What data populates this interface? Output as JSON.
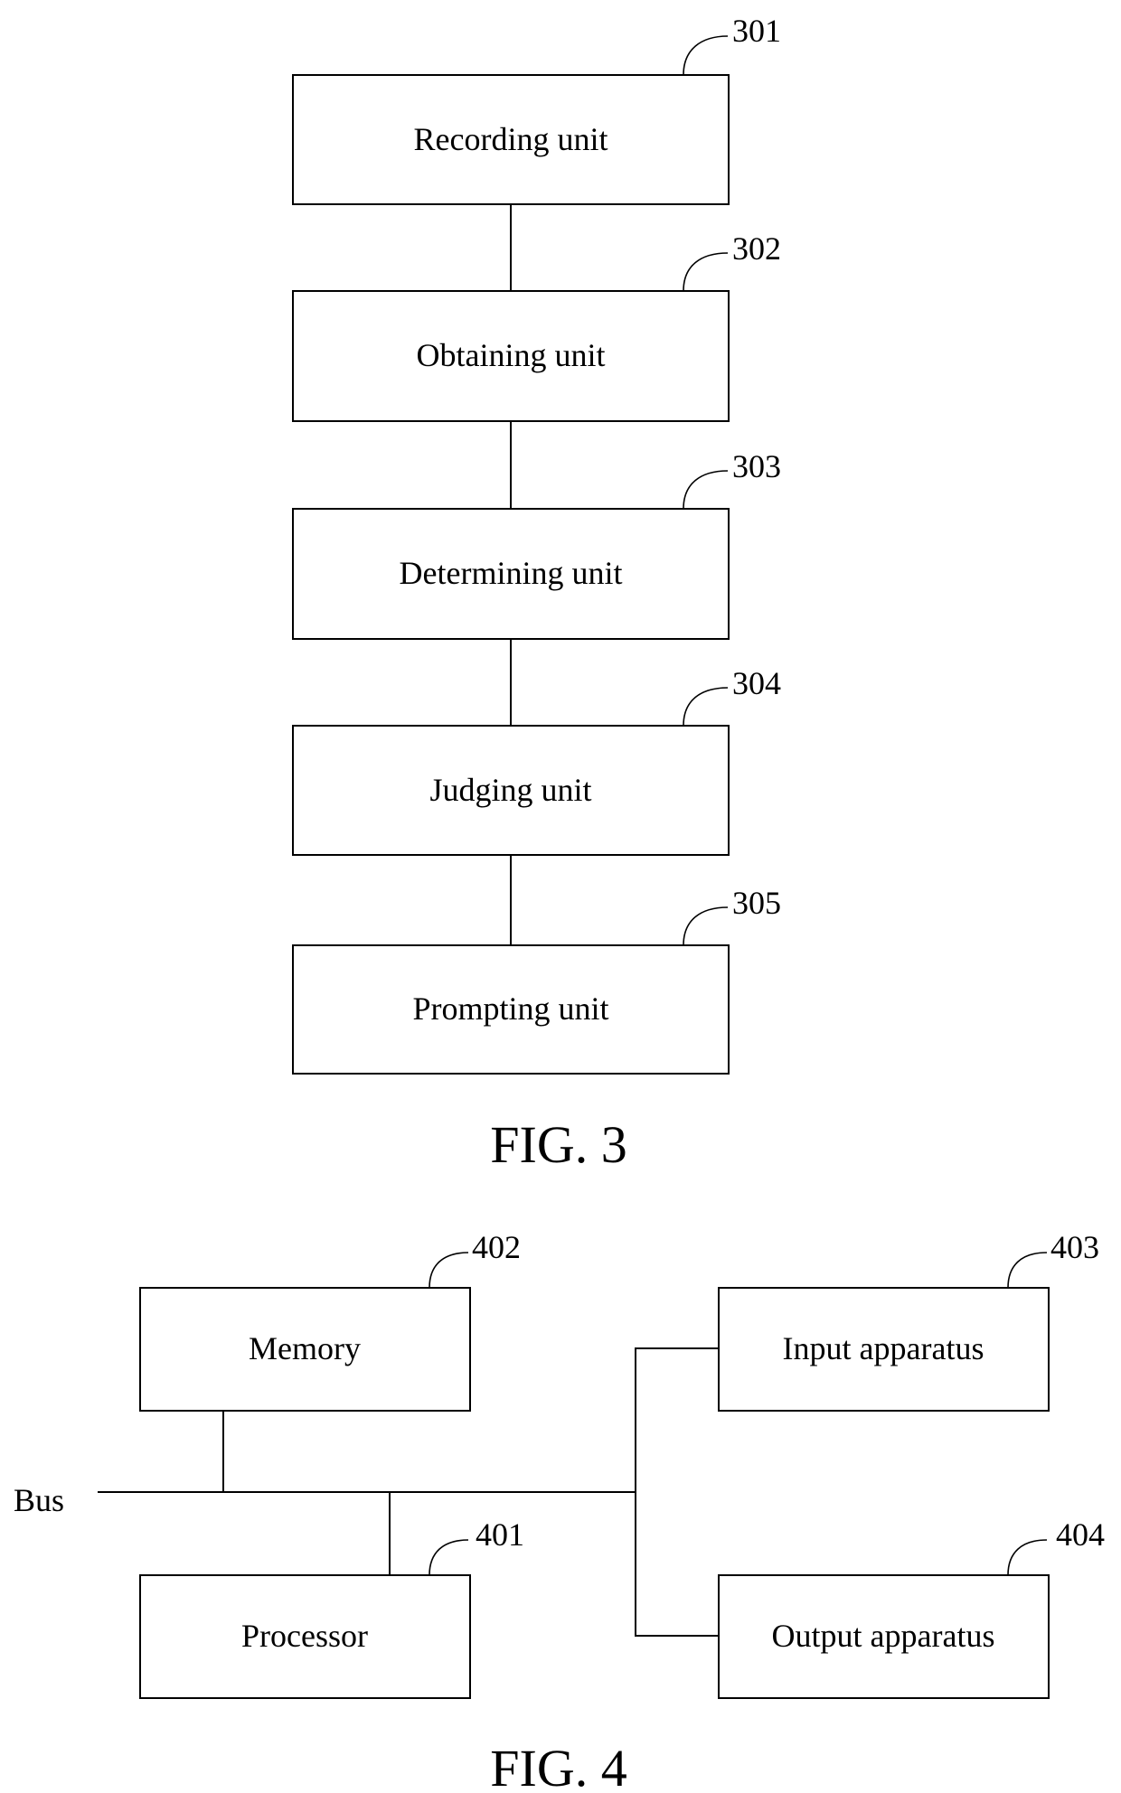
{
  "figures": [
    {
      "caption": "FIG. 3",
      "units": [
        {
          "ref": "301",
          "label": "Recording unit"
        },
        {
          "ref": "302",
          "label": "Obtaining unit"
        },
        {
          "ref": "303",
          "label": "Determining unit"
        },
        {
          "ref": "304",
          "label": "Judging unit"
        },
        {
          "ref": "305",
          "label": "Prompting unit"
        }
      ]
    },
    {
      "caption": "FIG. 4",
      "bus_label": "Bus",
      "memory": {
        "ref": "402",
        "label": "Memory"
      },
      "processor": {
        "ref": "401",
        "label": "Processor"
      },
      "input": {
        "ref": "403",
        "label": "Input apparatus"
      },
      "output": {
        "ref": "404",
        "label": "Output apparatus"
      }
    }
  ]
}
